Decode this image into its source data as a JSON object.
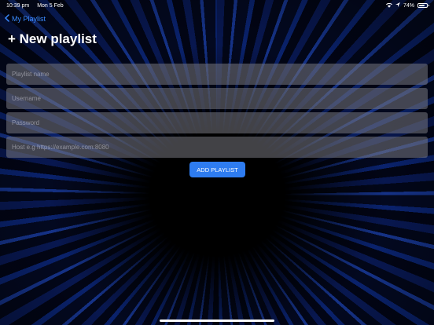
{
  "status_bar": {
    "time": "10:39 pm",
    "date": "Mon 5 Feb",
    "battery": "74%",
    "battery_level": 0.74
  },
  "nav": {
    "back_label": "My Playlist"
  },
  "page": {
    "title": "+ New playlist"
  },
  "form": {
    "playlist_name_placeholder": "Playlist name",
    "username_placeholder": "Username",
    "password_placeholder": "Password",
    "host_placeholder": "Host e.g https://example.com:8080",
    "submit_label": "ADD PLAYLIST"
  },
  "colors": {
    "accent": "#2e7cf0",
    "link": "#3a8bff"
  }
}
